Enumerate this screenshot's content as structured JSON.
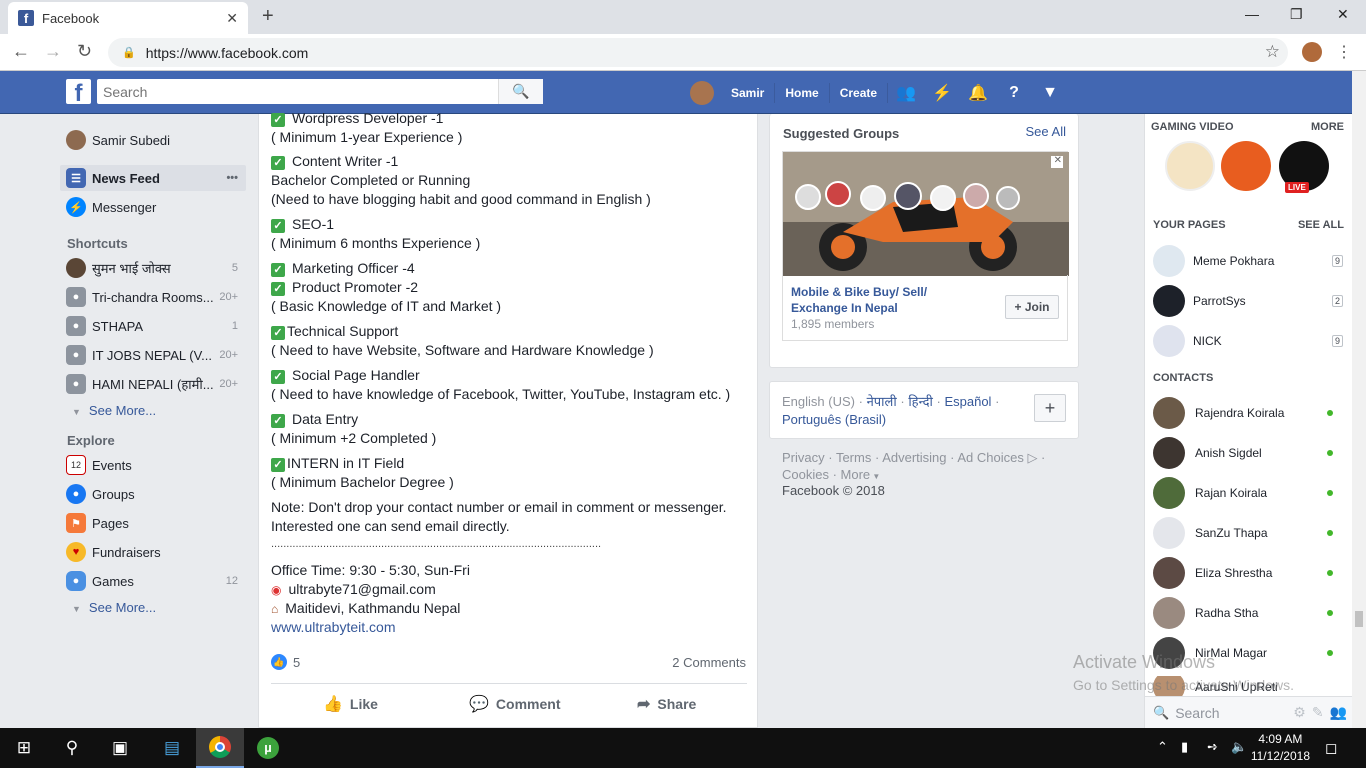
{
  "browser": {
    "tab_title": "Facebook",
    "url": "https://www.facebook.com",
    "new_tab": "+",
    "close_tab": "✕"
  },
  "fb": {
    "search_placeholder": "Search",
    "user": "Samir",
    "home": "Home",
    "create": "Create"
  },
  "left": {
    "profile": "Samir Subedi",
    "news_feed": "News Feed",
    "news_more": "•••",
    "messenger": "Messenger",
    "shortcuts_heading": "Shortcuts",
    "shortcuts": [
      {
        "label": "सुमन भाई जोक्स",
        "count": "5"
      },
      {
        "label": "Tri-chandra Rooms...",
        "count": "20+"
      },
      {
        "label": "STHAPA",
        "count": "1"
      },
      {
        "label": "IT JOBS NEPAL (V...",
        "count": "20+"
      },
      {
        "label": "HAMI NEPALI (हामी...",
        "count": "20+"
      }
    ],
    "see_more": "See More...",
    "explore_heading": "Explore",
    "explore": [
      {
        "label": "Events",
        "count": ""
      },
      {
        "label": "Groups",
        "count": ""
      },
      {
        "label": "Pages",
        "count": ""
      },
      {
        "label": "Fundraisers",
        "count": ""
      },
      {
        "label": "Games",
        "count": "12"
      }
    ],
    "see_more2": "See More..."
  },
  "post": {
    "lines": [
      "Wordpress Developer -1",
      "( Minimum 1-year Experience )",
      "Content Writer -1",
      "Bachelor Completed or Running",
      "(Need to have blogging habit and good command in English )",
      "SEO-1",
      "( Minimum 6 months Experience )",
      "Marketing Officer -4",
      "Product Promoter -2",
      "( Basic Knowledge of IT and Market )",
      "Technical Support",
      "( Need to have Website, Software and Hardware Knowledge )",
      "Social Page Handler",
      "( Need to have knowledge of Facebook, Twitter, YouTube, Instagram etc. )",
      "Data Entry",
      "( Minimum +2 Completed )",
      "INTERN in IT Field",
      "( Minimum Bachelor Degree )",
      "Note: Don't drop your contact number or email in comment or messenger.",
      "Interested one can send email directly.",
      "............................................................................................................",
      "Office Time: 9:30 - 5:30, Sun-Fri",
      "ultrabyte71@gmail.com",
      "Maitidevi, Kathmandu Nepal",
      "www.ultrabyteit.com"
    ],
    "likes": "5",
    "comments": "2 Comments",
    "like": "Like",
    "comment": "Comment",
    "share": "Share"
  },
  "suggested": {
    "title": "Suggested Groups",
    "see_all": "See All",
    "group_name": "Mobile & Bike Buy/ Sell/ Exchange In Nepal",
    "members": "1,895 members",
    "join": "+ Join",
    "close": "✕"
  },
  "languages": {
    "current": "English (US)",
    "l1": "नेपाली",
    "l2": "हिन्दी",
    "l3": "Español",
    "l4": "Português (Brasil)",
    "sep": "·",
    "plus": "+"
  },
  "footer": {
    "privacy": "Privacy",
    "terms": "Terms",
    "advertising": "Advertising",
    "ad_choices": "Ad Choices",
    "cookies": "Cookies",
    "more": "More",
    "copyright": "Facebook © 2018"
  },
  "chat": {
    "gaming_heading": "GAMING VIDEO",
    "gaming_more": "MORE",
    "live": "LIVE",
    "pages_heading": "YOUR PAGES",
    "pages_see_all": "SEE ALL",
    "pages": [
      {
        "name": "Meme Pokhara",
        "badge": "9"
      },
      {
        "name": "ParrotSys",
        "badge": "2"
      },
      {
        "name": "NICK",
        "badge": "9"
      }
    ],
    "contacts_heading": "CONTACTS",
    "contacts": [
      "Rajendra Koirala",
      "Anish Sigdel",
      "Rajan Koirala",
      "SanZu Thapa",
      "Eliza Shrestha",
      "Radha Stha",
      "NirMal Magar",
      "AaruShi UpReti"
    ],
    "search": "Search"
  },
  "watermark": {
    "line1": "Activate Windows",
    "line2": "Go to Settings to activate Windows."
  },
  "taskbar": {
    "time": "4:09 AM",
    "date": "11/12/2018"
  },
  "colors": {
    "fb_blue": "#4267b2",
    "link": "#365899",
    "online": "#42b72a",
    "check": "#3ea74a"
  }
}
